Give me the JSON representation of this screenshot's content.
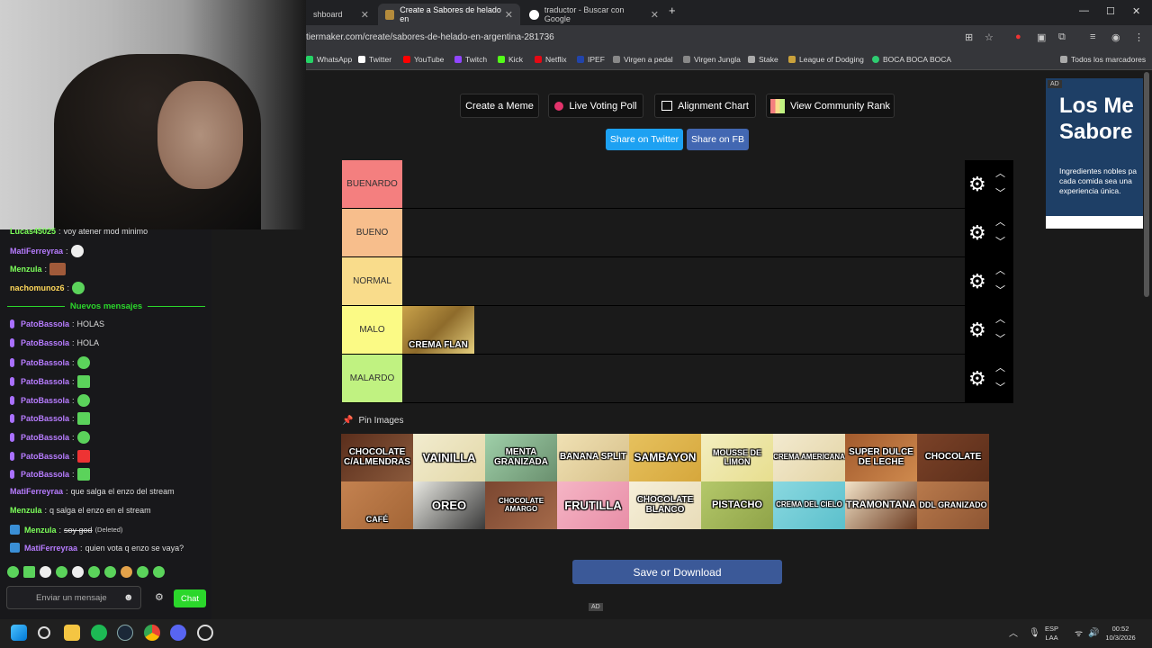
{
  "browser": {
    "tabs": [
      {
        "title": "shboard",
        "active": false
      },
      {
        "title": "Create a Sabores de helado en",
        "active": true
      },
      {
        "title": "traductor - Buscar con Google",
        "active": false
      }
    ],
    "new_tab": "+",
    "url": "tiermaker.com/create/sabores-de-helado-en-argentina-281736",
    "bookmarks": [
      "WhatsApp",
      "Twitter",
      "YouTube",
      "Twitch",
      "Kick",
      "Netflix",
      "IPEF",
      "Virgen a pedal",
      "Virgen Jungla",
      "Stake",
      "League of Dodging",
      "BOCA BOCA BOCA"
    ],
    "bookmarks_folder": "Todos los marcadores"
  },
  "toolbar": {
    "create_meme": "Create a Meme",
    "live_voting": "Live Voting Poll",
    "alignment_chart": "Alignment Chart",
    "community_rank": "View Community Rank",
    "share_twitter": "Share on Twitter",
    "share_fb": "Share on FB"
  },
  "tiers": [
    {
      "label": "BUENARDO",
      "color": "#f47f7f"
    },
    {
      "label": "BUENO",
      "color": "#f7be8c"
    },
    {
      "label": "NORMAL",
      "color": "#f9dc8b"
    },
    {
      "label": "MALO",
      "color": "#fbfa85"
    },
    {
      "label": "MALARDO",
      "color": "#c0f281"
    }
  ],
  "placed_items": {
    "malo": [
      "CREMA FLAN"
    ]
  },
  "pin_images": "Pin Images",
  "pool_row1": [
    "CHOCOLATE C/ALMENDRAS",
    "VAINILLA",
    "MENTA GRANIZADA",
    "BANANA SPLIT",
    "SAMBAYON",
    "MOUSSE DE LIMON",
    "CREMA AMERICANA",
    "SUPER DULCE DE LECHE",
    "CHOCOLATE"
  ],
  "pool_row2": [
    "CAFÉ",
    "OREO",
    "CHOCOLATE AMARGO",
    "FRUTILLA",
    "CHOCOLATE BLANCO",
    "PISTACHO",
    "CREMA DEL CIELO",
    "TRAMONTANA",
    "DDL GRANIZADO"
  ],
  "save_button": "Save or Download",
  "ad": {
    "tag": "AD",
    "title": "Los Me Sabore",
    "text": "Ingredientes nobles pa cada comida sea una experiencia única.",
    "bottom_tag": "AD"
  },
  "chat": {
    "top_line": {
      "user": "Lucas45025",
      "text": "voy atener mod minimo"
    },
    "pre_messages": [
      {
        "user": "MatiFerreyraa",
        "text": "",
        "color": "#b77cff"
      },
      {
        "user": "Menzula",
        "text": "",
        "color": "#7cff5a"
      },
      {
        "user": "nachomunoz6",
        "text": "",
        "color": "#ffd85a"
      }
    ],
    "new_messages_label": "Nuevos mensajes",
    "messages": [
      {
        "user": "PatoBassola",
        "text": "HOLAS"
      },
      {
        "user": "PatoBassola",
        "text": "HOLA"
      },
      {
        "user": "PatoBassola",
        "text": ""
      },
      {
        "user": "PatoBassola",
        "text": ""
      },
      {
        "user": "PatoBassola",
        "text": ""
      },
      {
        "user": "PatoBassola",
        "text": ""
      },
      {
        "user": "PatoBassola",
        "text": ""
      },
      {
        "user": "PatoBassola",
        "text": ""
      },
      {
        "user": "PatoBassola",
        "text": ""
      }
    ],
    "later": [
      {
        "user": "MatiFerreyraa",
        "text": "que salga el enzo del stream"
      },
      {
        "user": "Menzula",
        "text": "q salga el enzo en el stream"
      },
      {
        "user": "Menzula",
        "text": "soy god",
        "deleted": "(Deleted)"
      },
      {
        "user": "MatiFerreyraa",
        "text": "quien vota q enzo se vaya?"
      }
    ],
    "input_placeholder": "Enviar un mensaje",
    "send_button": "Chat"
  },
  "system": {
    "lang": "ESP",
    "lang2": "LAA",
    "time": "00:52",
    "date": "10/3/2026"
  }
}
